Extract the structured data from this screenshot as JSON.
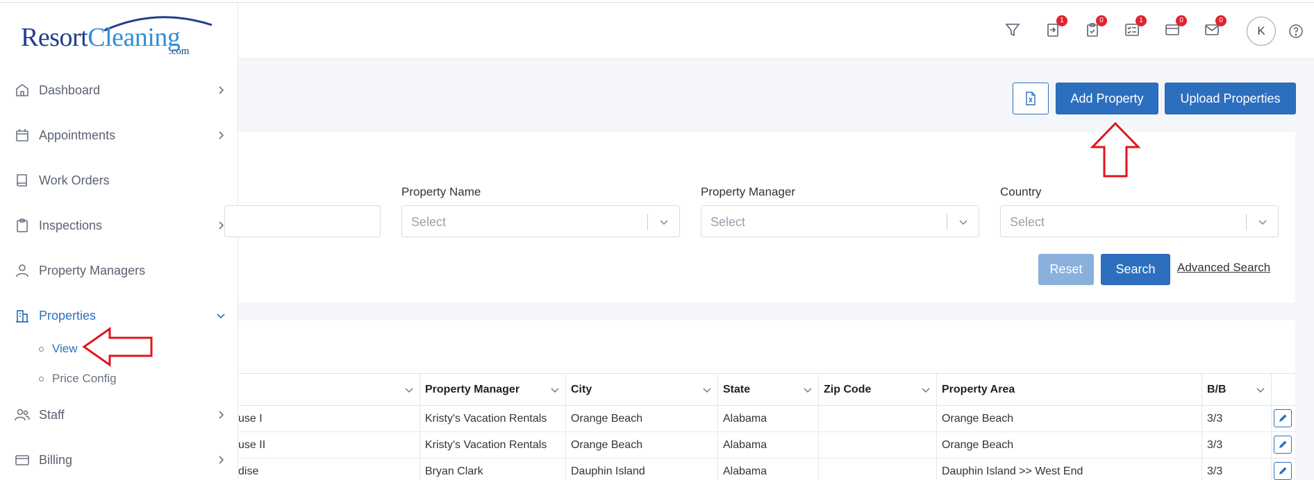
{
  "brand": {
    "part1": "Resort",
    "part2": "Cleaning",
    "suffix": ".com"
  },
  "header": {
    "icons": [
      {
        "name": "filter-icon",
        "badge": null
      },
      {
        "name": "import-icon",
        "badge": "1"
      },
      {
        "name": "clipboard-check-icon",
        "badge": "0"
      },
      {
        "name": "checklist-icon",
        "badge": "1"
      },
      {
        "name": "credit-card-icon",
        "badge": "0"
      },
      {
        "name": "mail-icon",
        "badge": "0"
      }
    ],
    "avatar": "K"
  },
  "sidebar": {
    "items": [
      {
        "label": "Dashboard",
        "icon": "home-icon"
      },
      {
        "label": "Appointments",
        "icon": "calendar-icon"
      },
      {
        "label": "Work Orders",
        "icon": "book-icon"
      },
      {
        "label": "Inspections",
        "icon": "clipboard-icon"
      },
      {
        "label": "Property Managers",
        "icon": "user-icon"
      },
      {
        "label": "Properties",
        "icon": "building-icon"
      },
      {
        "label": "Staff",
        "icon": "users-icon"
      },
      {
        "label": "Billing",
        "icon": "card-icon"
      }
    ],
    "sub": [
      {
        "label": "View"
      },
      {
        "label": "Price Config"
      }
    ]
  },
  "actions": {
    "add": "Add Property",
    "upload": "Upload Properties"
  },
  "filters": {
    "property_name": {
      "label": "Property Name",
      "placeholder": "Select"
    },
    "property_manager": {
      "label": "Property Manager",
      "placeholder": "Select"
    },
    "country": {
      "label": "Country",
      "placeholder": "Select"
    },
    "reset": "Reset",
    "search": "Search",
    "advanced": "Advanced Search"
  },
  "table": {
    "columns": [
      "Property Manager",
      "City",
      "State",
      "Zip Code",
      "Property Area",
      "B/B"
    ],
    "rows": [
      {
        "name": "use I",
        "manager": "Kristy's Vacation Rentals",
        "city": "Orange Beach",
        "state": "Alabama",
        "zip": "",
        "area": "Orange Beach",
        "bb": "3/3"
      },
      {
        "name": "use II",
        "manager": "Kristy's Vacation Rentals",
        "city": "Orange Beach",
        "state": "Alabama",
        "zip": "",
        "area": "Orange Beach",
        "bb": "3/3"
      },
      {
        "name": "dise",
        "manager": "Bryan Clark",
        "city": "Dauphin Island",
        "state": "Alabama",
        "zip": "",
        "area": "Dauphin Island >> West End",
        "bb": "3/3"
      }
    ]
  },
  "colors": {
    "primary": "#2d6fbf",
    "badge": "#e0242f",
    "annotation": "#e0141c"
  }
}
